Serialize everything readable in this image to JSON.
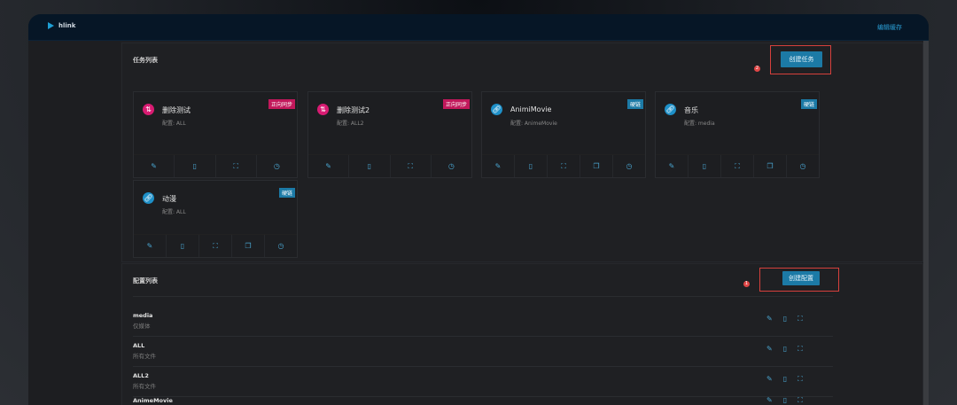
{
  "app": {
    "name": "hlink",
    "header_link": "编辑缓存"
  },
  "tasks": {
    "title": "任务列表",
    "create_label": "创建任务",
    "badge": "2",
    "items": [
      {
        "name": "删除测试",
        "config": "配置: ALL",
        "tag": "正向同步",
        "tag_color": "#c2185b",
        "icon": "sync-icon",
        "icon_color": "#d81b72",
        "actions": [
          "edit",
          "delete",
          "expand",
          "schedule"
        ]
      },
      {
        "name": "删除测试2",
        "config": "配置: ALL2",
        "tag": "正向同步",
        "tag_color": "#c2185b",
        "icon": "sync-icon",
        "icon_color": "#d81b72",
        "actions": [
          "edit",
          "delete",
          "expand",
          "schedule"
        ]
      },
      {
        "name": "AnimiMovie",
        "config": "配置: AnimeMovie",
        "tag": "硬链",
        "tag_color": "#1c7aa6",
        "icon": "link-icon",
        "icon_color": "#1e90c8",
        "actions": [
          "edit",
          "delete",
          "expand",
          "copy",
          "schedule"
        ]
      },
      {
        "name": "音乐",
        "config": "配置: media",
        "tag": "硬链",
        "tag_color": "#1c7aa6",
        "icon": "link-icon",
        "icon_color": "#1e90c8",
        "actions": [
          "edit",
          "delete",
          "expand",
          "copy",
          "schedule"
        ]
      },
      {
        "name": "动漫",
        "config": "配置: ALL",
        "tag": "硬链",
        "tag_color": "#1c7aa6",
        "icon": "link-icon",
        "icon_color": "#1e90c8",
        "actions": [
          "edit",
          "delete",
          "expand",
          "copy",
          "schedule"
        ]
      }
    ]
  },
  "configs": {
    "title": "配置列表",
    "create_label": "创建配置",
    "badge": "1",
    "items": [
      {
        "name": "media",
        "desc": "仅媒体"
      },
      {
        "name": "ALL",
        "desc": "所有文件"
      },
      {
        "name": "ALL2",
        "desc": "所有文件"
      },
      {
        "name": "AnimeMovie",
        "desc": ""
      }
    ]
  }
}
